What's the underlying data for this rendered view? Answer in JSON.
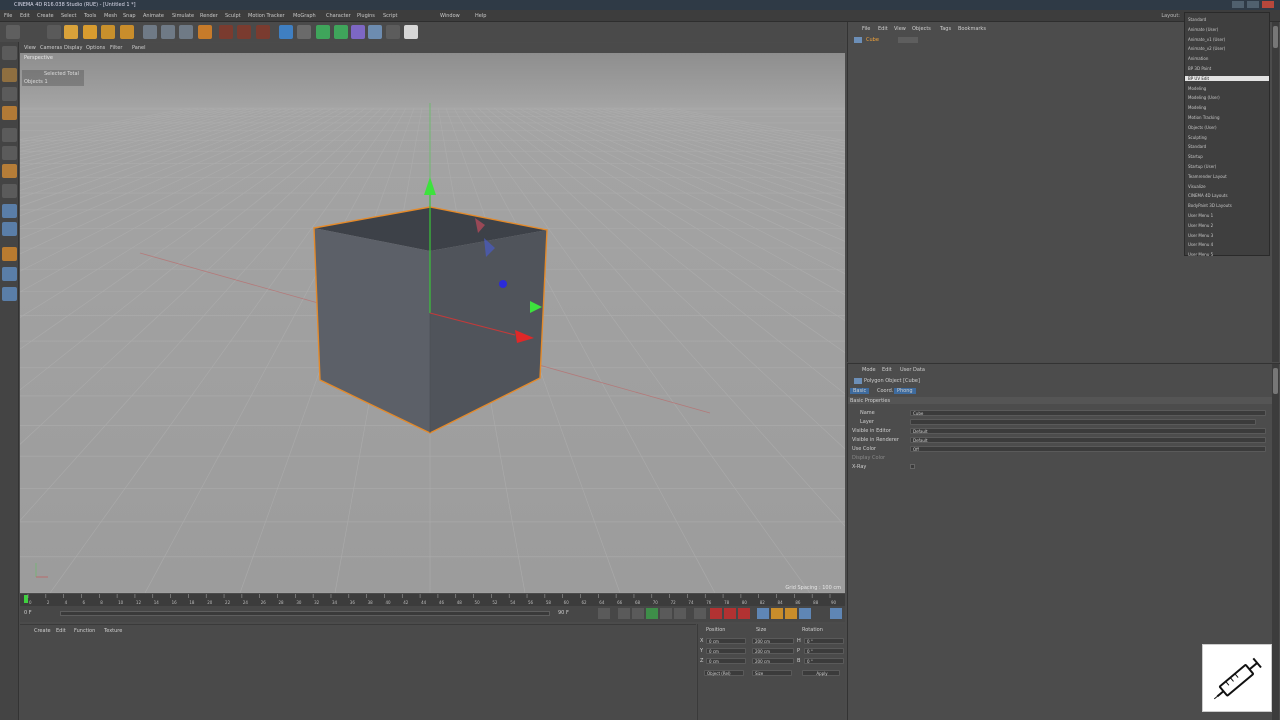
{
  "app": {
    "title": "CINEMA 4D R16.038 Studio (RUE) - [Untitled 1 *]",
    "layout_label": "Layout:"
  },
  "menu": [
    "File",
    "Edit",
    "Create",
    "Select",
    "Tools",
    "Mesh",
    "Snap",
    "Animate",
    "Simulate",
    "Render",
    "Sculpt",
    "Motion Tracker",
    "MoGraph",
    "Character",
    "Plugins",
    "Script",
    "Window",
    "Help"
  ],
  "viewport": {
    "menu": [
      "View",
      "Cameras",
      "Display",
      "Options",
      "Filter",
      "Panel"
    ],
    "label": "Perspective",
    "hud_label": "Selected Total",
    "hud_objects": "Objects 1",
    "grid_spacing": "Grid Spacing : 100 cm",
    "colors": {
      "bg_top": "#8d8d8d",
      "bg_bottom": "#a4a4a4",
      "cube_front": "#5a5e66",
      "cube_side": "#4e5259",
      "cube_top": "#3f434a",
      "highlight": "#e48a2a"
    }
  },
  "timeline": {
    "ticks": [
      "0",
      "2",
      "4",
      "6",
      "8",
      "10",
      "12",
      "14",
      "16",
      "18",
      "20",
      "22",
      "24",
      "26",
      "28",
      "30",
      "32",
      "34",
      "36",
      "38",
      "40",
      "42",
      "44",
      "46",
      "48",
      "50",
      "52",
      "54",
      "56",
      "58",
      "60",
      "62",
      "64",
      "66",
      "68",
      "70",
      "72",
      "74",
      "76",
      "78",
      "80",
      "82",
      "84",
      "86",
      "88",
      "90"
    ],
    "current_frame": "0 F",
    "start": "0 F",
    "end": "90 F",
    "end2": "90 F"
  },
  "material_manager": {
    "menu": [
      "Create",
      "Edit",
      "Function",
      "Texture"
    ]
  },
  "coordinates": {
    "headers": [
      "Position",
      "Size",
      "Rotation"
    ],
    "rows": [
      {
        "axis": "X",
        "pos": "0 cm",
        "size": "200 cm",
        "rot_axis": "H",
        "rot": "0 °"
      },
      {
        "axis": "Y",
        "pos": "0 cm",
        "size": "200 cm",
        "rot_axis": "P",
        "rot": "0 °"
      },
      {
        "axis": "Z",
        "pos": "0 cm",
        "size": "200 cm",
        "rot_axis": "B",
        "rot": "0 °"
      }
    ],
    "mode": "Object (Rel)",
    "size_mode": "Size",
    "apply": "Apply"
  },
  "object_manager": {
    "menu": [
      "File",
      "Edit",
      "View",
      "Objects",
      "Tags",
      "Bookmarks"
    ],
    "object_name": "Cube"
  },
  "attribute_manager": {
    "menu": [
      "Mode",
      "Edit",
      "User Data"
    ],
    "object_label": "Polygon Object [Cube]",
    "tabs": [
      "Basic",
      "Coord.",
      "Phong"
    ],
    "section": "Basic Properties",
    "fields": [
      {
        "label": "Name",
        "value": "Cube"
      },
      {
        "label": "Layer",
        "value": ""
      },
      {
        "label": "Visible in Editor",
        "value": "Default"
      },
      {
        "label": "Visible in Renderer",
        "value": "Default"
      },
      {
        "label": "Use Color",
        "value": "Off"
      },
      {
        "label": "Display Color",
        "value": ""
      },
      {
        "label": "X-Ray",
        "value": ""
      }
    ]
  },
  "dropdown": {
    "items": [
      "Standard",
      "Animate (User)",
      "Animate_v1 (User)",
      "Animate_v2 (User)",
      "Animation",
      "BP 3D Paint",
      "BP UV Edit",
      "Modeling",
      "Modeling (User)",
      "Modeling",
      "Motion Tracking",
      "Objects (User)",
      "Sculpting",
      "Standard",
      "Startup",
      "Startup (User)",
      "Teamrender Layout",
      "Visualize",
      "CINEMA 4D Layouts",
      "BodyPaint 3D Layouts",
      "User Menu 1",
      "User Menu 2",
      "User Menu 3",
      "User Menu 4",
      "User Menu 5"
    ],
    "selected_index": 6
  }
}
